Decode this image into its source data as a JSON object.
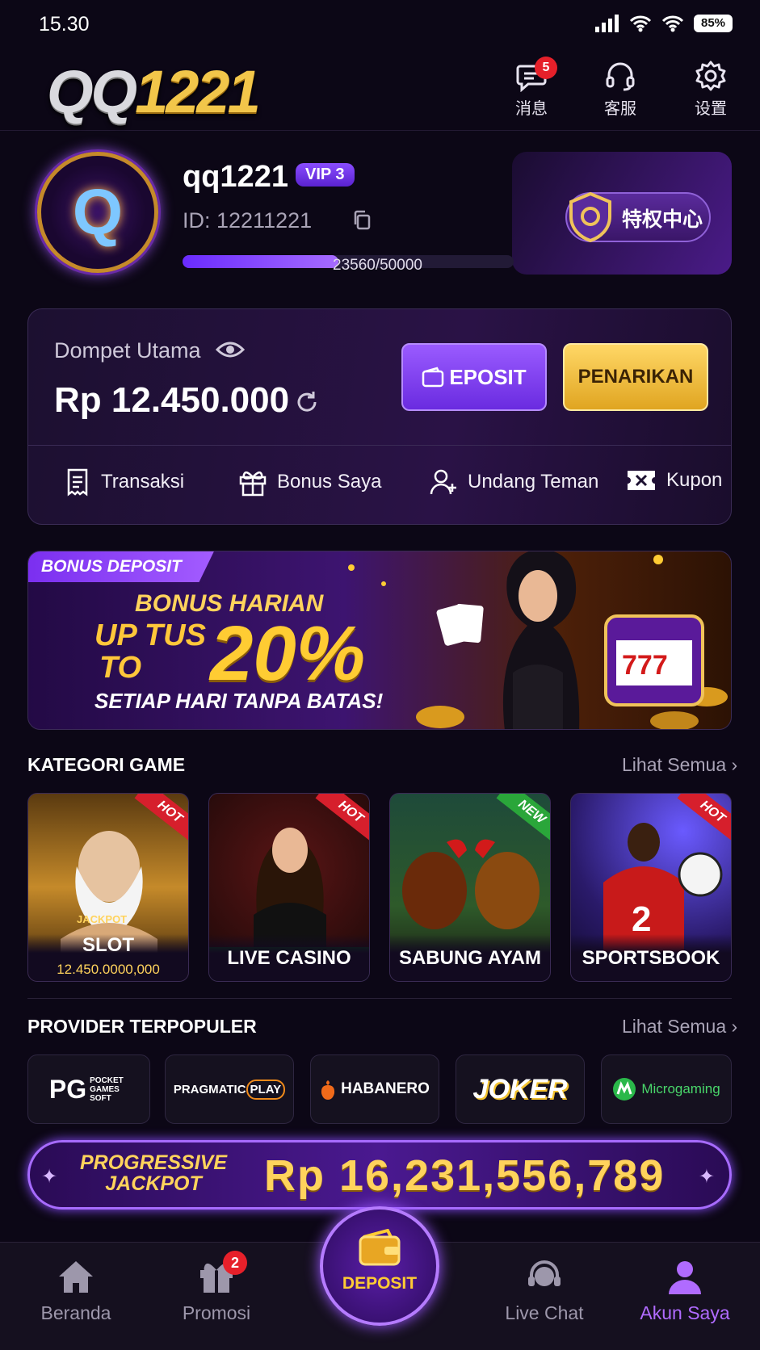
{
  "status": {
    "time": "15.30",
    "battery": "85%"
  },
  "header": {
    "logo_a": "QQ",
    "logo_b": "1221",
    "messages": {
      "label": "消息",
      "count": "5"
    },
    "support": {
      "label": "客服"
    },
    "settings": {
      "label": "设置"
    }
  },
  "profile": {
    "username": "qq1221",
    "vip": "VIP 3",
    "id": "ID: 12211221",
    "progress_text": "23560/50000",
    "progress_fraction": 0.4712,
    "privilege": "特权中心"
  },
  "wallet": {
    "label": "Dompet Utama",
    "amount": "Rp 12.450.000",
    "deposit": "EPOSIT",
    "withdraw": "PENARIKAN",
    "actions": [
      "Transaksi",
      "Bonus Saya",
      "Undang Teman",
      "Kupon"
    ]
  },
  "banner": {
    "tag": "BONUS DEPOSIT",
    "line1": "BONUS HARIAN",
    "line2": "UP TUS",
    "line3": "TO",
    "percent": "20%",
    "line4": "SETIAP HARI TANPA BATAS!"
  },
  "games": {
    "title": "KATEGORI GAME",
    "more": "Lihat Semua",
    "items": [
      {
        "label": "SLOT",
        "sub": "12.450.0000,000",
        "ribbon": "HOT",
        "jackpot_tag": "JACKPOT"
      },
      {
        "label": "LIVE CASINO",
        "ribbon": "HOT"
      },
      {
        "label": "SABUNG AYAM",
        "ribbon": "NEW"
      },
      {
        "label": "SPORTSBOOK",
        "ribbon": "HOT"
      }
    ]
  },
  "providers": {
    "title": "PROVIDER TERPOPULER",
    "more": "Lihat Semua",
    "items": [
      {
        "a": "PG",
        "b": "POCKET GAMES SOFT"
      },
      {
        "a": "PRAGMATIC",
        "b": "PLAY"
      },
      {
        "a": "HABANERO"
      },
      {
        "a": "JOKER"
      },
      {
        "a": "Microgaming"
      }
    ]
  },
  "jackpot": {
    "label1": "PROGRESSIVE",
    "label2": "JACKPOT",
    "amount": "Rp 16,231,556,789"
  },
  "nav": {
    "home": "Beranda",
    "promo": "Promosi",
    "promo_count": "2",
    "deposit": "DEPOSIT",
    "livechat": "Live Chat",
    "account": "Akun Saya"
  },
  "colors": {
    "accent": "#8a4dff",
    "gold": "#ffcc33",
    "active_nav": "#b06bff"
  }
}
